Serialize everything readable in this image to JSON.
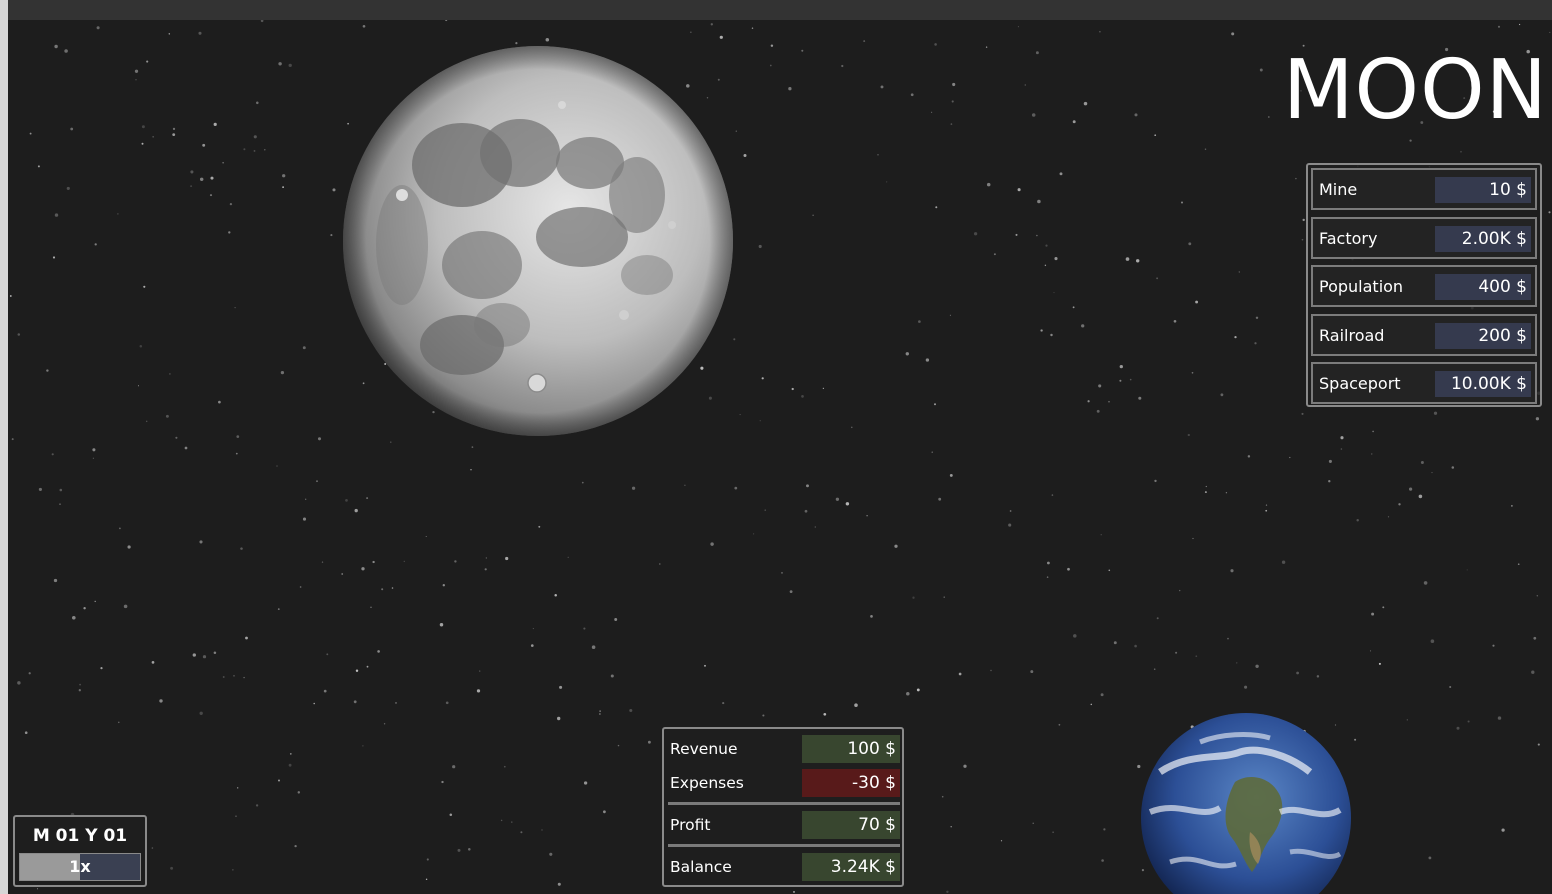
{
  "game": {
    "planet_name": "MOON",
    "colors": {
      "background": "#1d1d1d",
      "value_box": "#353a4e",
      "positive": "#38462f",
      "negative": "#581a1a"
    }
  },
  "build_costs": [
    {
      "label": "Mine",
      "value": "10 $"
    },
    {
      "label": "Factory",
      "value": "2.00K $"
    },
    {
      "label": "Population",
      "value": "400 $"
    },
    {
      "label": "Railroad",
      "value": "200 $"
    },
    {
      "label": "Spaceport",
      "value": "10.00K $"
    }
  ],
  "finance": {
    "revenue": {
      "label": "Revenue",
      "value": "100 $"
    },
    "expenses": {
      "label": "Expenses",
      "value": "-30 $"
    },
    "profit": {
      "label": "Profit",
      "value": "70 $"
    },
    "balance": {
      "label": "Balance",
      "value": "3.24K $"
    }
  },
  "time": {
    "date": "M 01 Y 01",
    "speed_label": "1x",
    "speed_progress": 0.5
  },
  "icons": {
    "moon": "moon-icon",
    "earth": "earth-icon"
  }
}
